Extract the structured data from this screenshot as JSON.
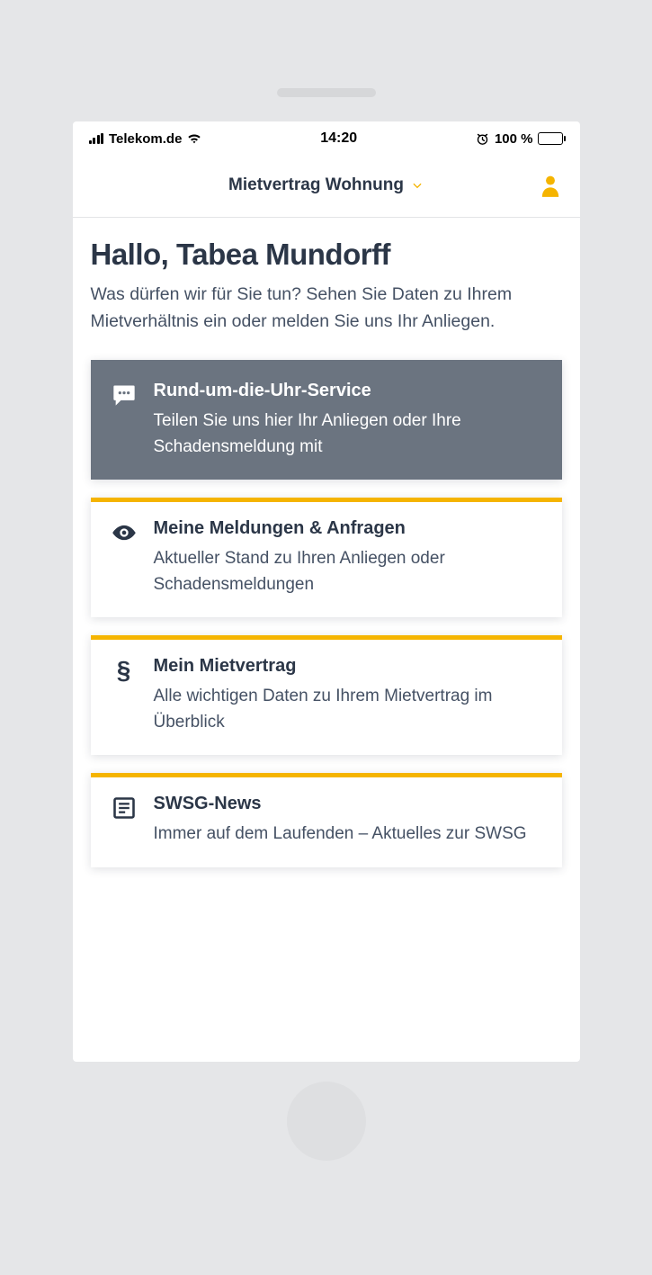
{
  "status_bar": {
    "carrier": "Telekom.de",
    "time": "14:20",
    "battery_percent": "100 %"
  },
  "header": {
    "title": "Mietvertrag Wohnung"
  },
  "greeting": "Hallo, Tabea Mundorff",
  "subtitle": "Was dürfen wir für Sie tun? Sehen Sie Daten zu Ihrem Mietverhältnis ein oder melden Sie uns Ihr Anliegen.",
  "cards": [
    {
      "icon": "chat-icon",
      "title": "Rund-um-die-Uhr-Service",
      "desc": "Teilen Sie uns hier Ihr Anliegen oder Ihre Schadensmeldung mit",
      "active": true
    },
    {
      "icon": "eye-icon",
      "title": "Meine Meldungen & Anfragen",
      "desc": "Aktueller Stand zu Ihren Anliegen oder Schadensmeldungen",
      "active": false
    },
    {
      "icon": "section-icon",
      "title": "Mein Mietvertrag",
      "desc": "Alle wichtigen Daten zu Ihrem Mietvertrag im Überblick",
      "active": false
    },
    {
      "icon": "news-icon",
      "title": "SWSG-News",
      "desc": "Immer auf dem Laufenden – Aktuelles zur SWSG",
      "active": false
    }
  ],
  "colors": {
    "accent": "#f5b400",
    "text_dark": "#2b3647",
    "text_body": "#455164",
    "card_active_bg": "#6b7480"
  }
}
